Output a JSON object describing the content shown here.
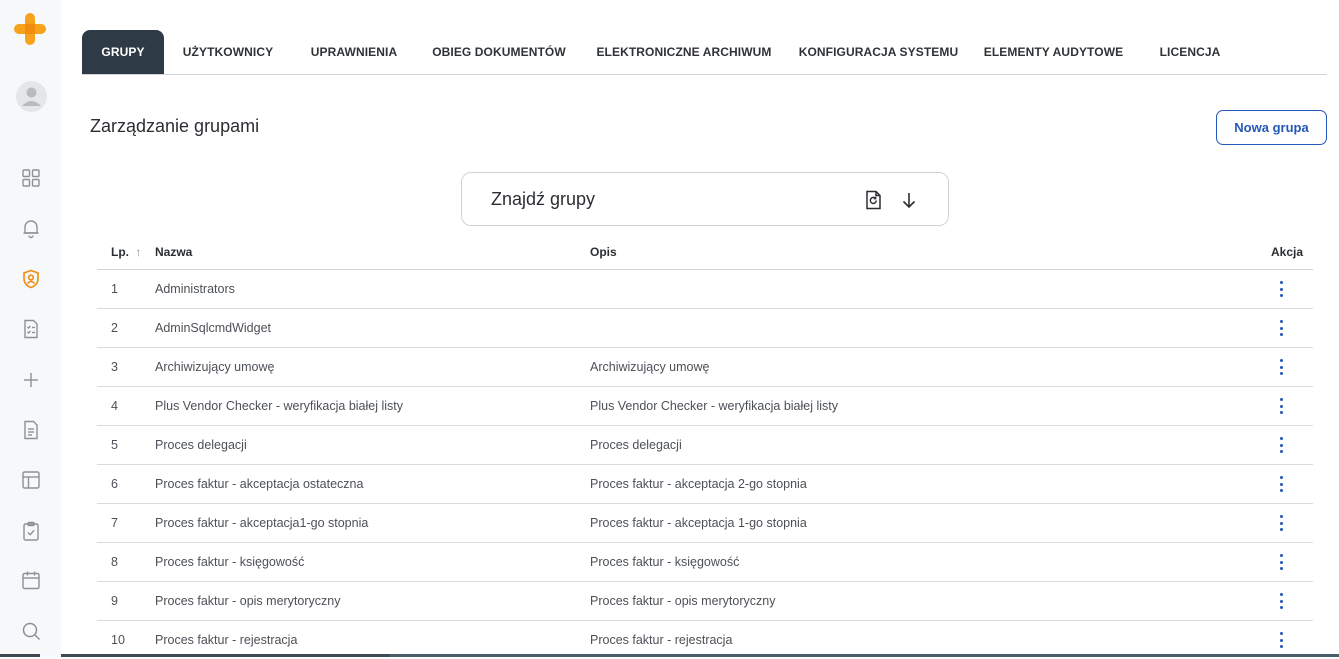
{
  "app": {
    "logo_icon": "orange-plus-logo",
    "accent_color": "#f7a21b",
    "primary_color": "#2458b8",
    "tab_active_bg": "#2e3a45"
  },
  "sidebar": {
    "items": [
      {
        "icon": "dashboard-grid-icon"
      },
      {
        "icon": "bell-icon"
      },
      {
        "icon": "user-shield-icon",
        "active": true
      },
      {
        "icon": "checklist-document-icon"
      },
      {
        "icon": "plus-icon"
      },
      {
        "icon": "document-icon"
      },
      {
        "icon": "layout-icon"
      },
      {
        "icon": "clipboard-check-icon"
      },
      {
        "icon": "calendar-icon"
      },
      {
        "icon": "search-icon"
      }
    ]
  },
  "tabs": [
    {
      "label": "GRUPY",
      "active": true
    },
    {
      "label": "UŻYTKOWNICY"
    },
    {
      "label": "UPRAWNIENIA"
    },
    {
      "label": "OBIEG DOKUMENTÓW"
    },
    {
      "label": "ELEKTRONICZNE ARCHIWUM"
    },
    {
      "label": "KONFIGURACJA SYSTEMU"
    },
    {
      "label": "ELEMENTY AUDYTOWE"
    },
    {
      "label": "LICENCJA"
    }
  ],
  "page": {
    "title": "Zarządzanie grupami",
    "new_button": "Nowa grupa"
  },
  "search": {
    "label": "Znajdź grupy"
  },
  "table": {
    "headers": {
      "lp": "Lp.",
      "name": "Nazwa",
      "description": "Opis",
      "action": "Akcja"
    },
    "sort_indicator": "↑",
    "rows": [
      {
        "lp": "1",
        "name": "Administrators",
        "description": ""
      },
      {
        "lp": "2",
        "name": "AdminSqlcmdWidget",
        "description": ""
      },
      {
        "lp": "3",
        "name": "Archiwizujący umowę",
        "description": "Archiwizujący umowę"
      },
      {
        "lp": "4",
        "name": "Plus Vendor Checker - weryfikacja białej listy",
        "description": "Plus Vendor Checker - weryfikacja białej listy"
      },
      {
        "lp": "5",
        "name": "Proces delegacji",
        "description": "Proces delegacji"
      },
      {
        "lp": "6",
        "name": "Proces faktur - akceptacja ostateczna",
        "description": "Proces faktur - akceptacja 2-go stopnia"
      },
      {
        "lp": "7",
        "name": "Proces faktur - akceptacja1-go stopnia",
        "description": "Proces faktur - akceptacja 1-go stopnia"
      },
      {
        "lp": "8",
        "name": "Proces faktur - księgowość",
        "description": "Proces faktur - księgowość"
      },
      {
        "lp": "9",
        "name": "Proces faktur - opis merytoryczny",
        "description": "Proces faktur - opis merytoryczny"
      },
      {
        "lp": "10",
        "name": "Proces faktur - rejestracja",
        "description": "Proces faktur - rejestracja"
      }
    ]
  }
}
